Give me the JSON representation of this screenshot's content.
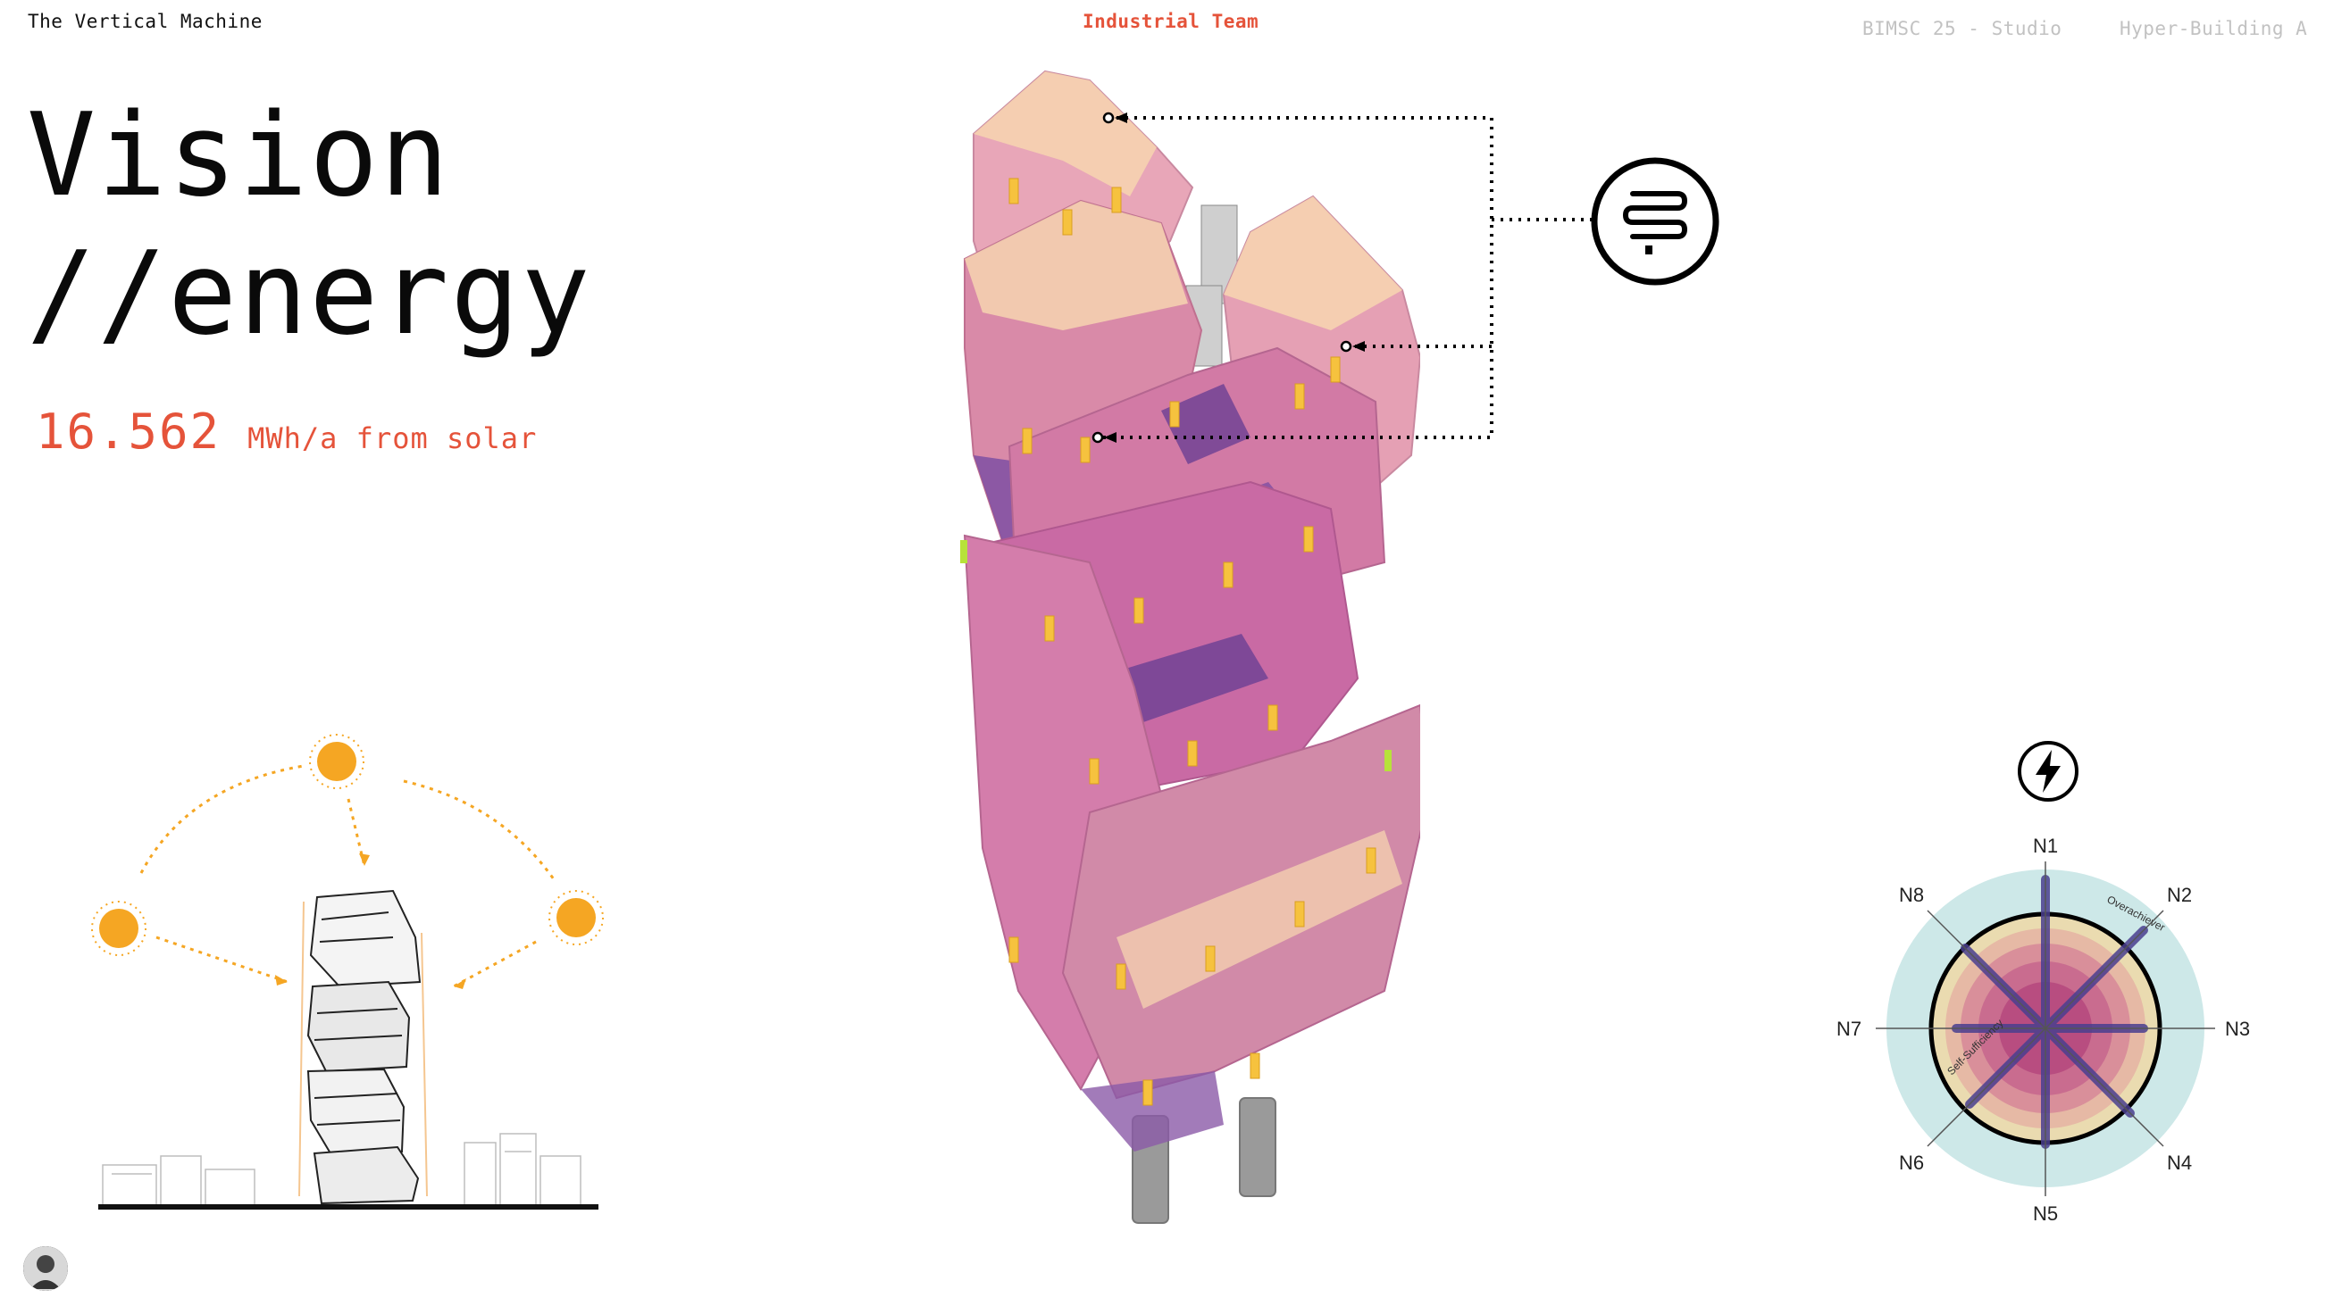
{
  "header": {
    "doc_title": "The Vertical Machine",
    "team": "Industrial Team",
    "course": "BIMSC 25 - Studio",
    "building": "Hyper-Building A"
  },
  "title": {
    "line1": "Vision",
    "line2": "//energy"
  },
  "metric": {
    "value": "16.562",
    "unit": "MWh/a from solar"
  },
  "radar": {
    "labels": [
      "N1",
      "N2",
      "N3",
      "N4",
      "N5",
      "N6",
      "N7",
      "N8"
    ],
    "outer_label": "Overachiever",
    "inner_label": "Self-Sufficiency"
  },
  "icons": {
    "diagram_icon": "heating-coil-icon",
    "radar_icon": "lightning-icon"
  },
  "colors": {
    "accent": "#e5533a",
    "sun": "#f5a623",
    "radar_outer": "#cde8e8",
    "radar_core": "#c0457a",
    "radar_axes": "#4a3f8f"
  }
}
